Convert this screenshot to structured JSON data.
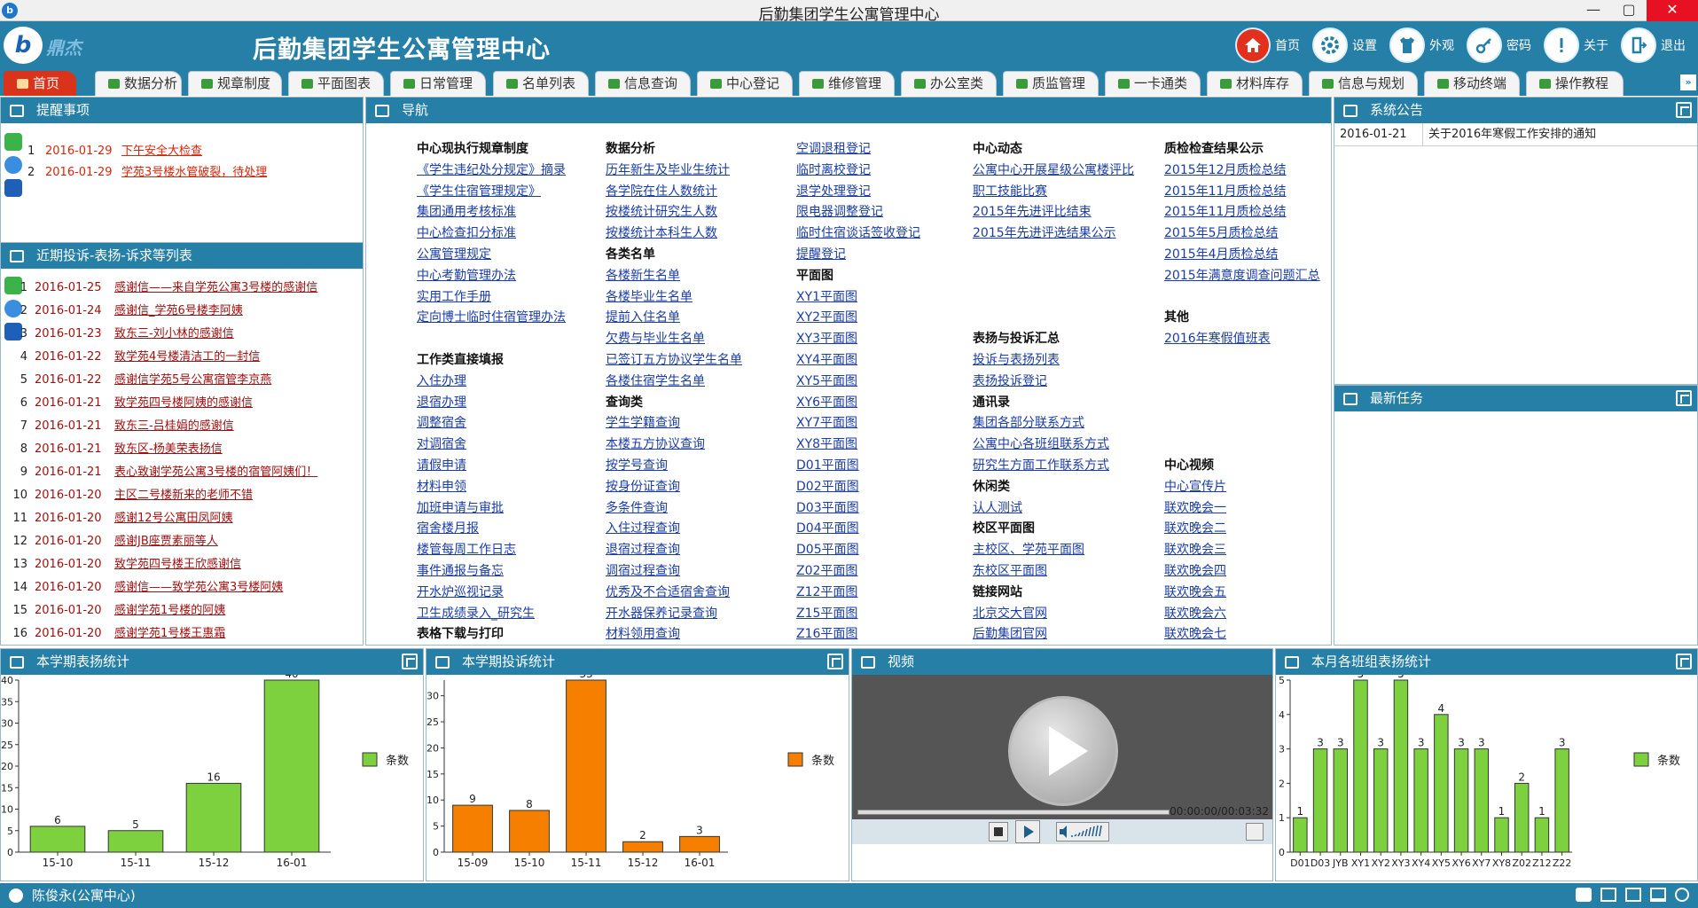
{
  "window": {
    "title": "后勤集团学生公寓管理中心"
  },
  "header": {
    "logo_text": "鼎杰",
    "app_title": "后勤集团学生公寓管理中心",
    "nav": [
      {
        "label": "首页",
        "icon": "home-icon"
      },
      {
        "label": "设置",
        "icon": "gear-icon"
      },
      {
        "label": "外观",
        "icon": "shirt-icon"
      },
      {
        "label": "密码",
        "icon": "key-icon"
      },
      {
        "label": "关于",
        "icon": "info-icon"
      },
      {
        "label": "退出",
        "icon": "exit-icon"
      }
    ]
  },
  "tabs": [
    "首页",
    "数据分析",
    "规章制度",
    "平面图表",
    "日常管理",
    "名单列表",
    "信息查询",
    "中心登记",
    "维修管理",
    "办公室类",
    "质监管理",
    "一卡通类",
    "材料库存",
    "信息与规划",
    "移动终端",
    "操作教程"
  ],
  "reminders": {
    "title": "提醒事项",
    "items": [
      {
        "num": "1",
        "date": "2016-01-29",
        "text": "下午安全大检查"
      },
      {
        "num": "2",
        "date": "2016-01-29",
        "text": "学苑3号楼水管破裂，待处理"
      }
    ]
  },
  "complaints": {
    "title": "近期投诉-表扬-诉求等列表",
    "items": [
      {
        "num": "1",
        "date": "2016-01-25",
        "text": "感谢信——来自学苑公寓3号楼的感谢信"
      },
      {
        "num": "2",
        "date": "2016-01-24",
        "text": "感谢信_学苑6号楼李阿姨"
      },
      {
        "num": "3",
        "date": "2016-01-23",
        "text": "致东三-刘小林的感谢信"
      },
      {
        "num": "4",
        "date": "2016-01-22",
        "text": "致学苑4号楼清洁工的一封信"
      },
      {
        "num": "5",
        "date": "2016-01-22",
        "text": "感谢信学苑5号公寓宿管李京燕"
      },
      {
        "num": "6",
        "date": "2016-01-21",
        "text": "致学苑四号楼阿姨的感谢信"
      },
      {
        "num": "7",
        "date": "2016-01-21",
        "text": "致东三-吕桂娟的感谢信"
      },
      {
        "num": "8",
        "date": "2016-01-21",
        "text": "致东区-杨美荣表扬信"
      },
      {
        "num": "9",
        "date": "2016-01-21",
        "text": "表心致谢学苑公寓3号楼的宿管阿姨们！"
      },
      {
        "num": "10",
        "date": "2016-01-20",
        "text": "主区二号楼新来的老师不错"
      },
      {
        "num": "11",
        "date": "2016-01-20",
        "text": "感谢12号公寓田凤阿姨"
      },
      {
        "num": "12",
        "date": "2016-01-20",
        "text": "感谢JB座贾素丽等人"
      },
      {
        "num": "13",
        "date": "2016-01-20",
        "text": "致学苑四号楼王欣感谢信"
      },
      {
        "num": "14",
        "date": "2016-01-20",
        "text": "感谢信——致学苑公寓3号楼阿姨"
      },
      {
        "num": "15",
        "date": "2016-01-20",
        "text": "感谢学苑1号楼的阿姨"
      },
      {
        "num": "16",
        "date": "2016-01-20",
        "text": "感谢学苑1号楼王惠霜"
      }
    ]
  },
  "nav_panel": {
    "title": "导航",
    "columns": [
      [
        {
          "t": "h",
          "text": "中心现执行规章制度"
        },
        {
          "t": "l",
          "text": "《学生违纪处分规定》摘录"
        },
        {
          "t": "l",
          "text": "《学生住宿管理规定》"
        },
        {
          "t": "l",
          "text": "集团通用考核标准"
        },
        {
          "t": "l",
          "text": "中心检查扣分标准"
        },
        {
          "t": "l",
          "text": "公寓管理规定"
        },
        {
          "t": "l",
          "text": "中心考勤管理办法"
        },
        {
          "t": "l",
          "text": "实用工作手册"
        },
        {
          "t": "l",
          "text": "定向博士临时住宿管理办法"
        },
        {
          "t": "e",
          "text": ""
        },
        {
          "t": "h",
          "text": "工作类直接填报"
        },
        {
          "t": "l",
          "text": "入住办理"
        },
        {
          "t": "l",
          "text": "退宿办理"
        },
        {
          "t": "l",
          "text": "调整宿舍"
        },
        {
          "t": "l",
          "text": "对调宿舍"
        },
        {
          "t": "l",
          "text": "请假申请"
        },
        {
          "t": "l",
          "text": "材料申领"
        },
        {
          "t": "l",
          "text": "加班申请与审批"
        },
        {
          "t": "l",
          "text": "宿舍楼月报"
        },
        {
          "t": "l",
          "text": "楼管每周工作日志"
        },
        {
          "t": "l",
          "text": "事件通报与备忘"
        },
        {
          "t": "l",
          "text": "开水炉巡视记录"
        },
        {
          "t": "l",
          "text": "卫生成绩录入_研究生"
        },
        {
          "t": "h",
          "text": "表格下载与打印"
        }
      ],
      [
        {
          "t": "h",
          "text": "数据分析"
        },
        {
          "t": "l",
          "text": "历年新生及毕业生统计"
        },
        {
          "t": "l",
          "text": "各学院在住人数统计"
        },
        {
          "t": "l",
          "text": "按楼统计研究生人数"
        },
        {
          "t": "l",
          "text": "按楼统计本科生人数"
        },
        {
          "t": "h",
          "text": "各类名单"
        },
        {
          "t": "l",
          "text": "各楼新生名单"
        },
        {
          "t": "l",
          "text": "各楼毕业生名单"
        },
        {
          "t": "l",
          "text": "提前入住名单"
        },
        {
          "t": "l",
          "text": "欠费与毕业生名单"
        },
        {
          "t": "l",
          "text": "已签订五方协议学生名单"
        },
        {
          "t": "l",
          "text": "各楼住宿学生名单"
        },
        {
          "t": "h",
          "text": "查询类"
        },
        {
          "t": "l",
          "text": "学生学籍查询"
        },
        {
          "t": "l",
          "text": "本楼五方协议查询"
        },
        {
          "t": "l",
          "text": "按学号查询"
        },
        {
          "t": "l",
          "text": "按身份证查询"
        },
        {
          "t": "l",
          "text": "多条件查询"
        },
        {
          "t": "l",
          "text": "入住过程查询"
        },
        {
          "t": "l",
          "text": "退宿过程查询"
        },
        {
          "t": "l",
          "text": "调宿过程查询"
        },
        {
          "t": "l",
          "text": "优秀及不合适宿舍查询"
        },
        {
          "t": "l",
          "text": "开水器保养记录查询"
        },
        {
          "t": "l",
          "text": "材料领用查询"
        }
      ],
      [
        {
          "t": "l",
          "text": "空调退租登记"
        },
        {
          "t": "l",
          "text": "临时离校登记"
        },
        {
          "t": "l",
          "text": "退学处理登记"
        },
        {
          "t": "l",
          "text": "限电器调整登记"
        },
        {
          "t": "l",
          "text": "临时住宿谈话签收登记"
        },
        {
          "t": "l",
          "text": "提醒登记"
        },
        {
          "t": "h",
          "text": "平面图"
        },
        {
          "t": "l",
          "text": "XY1平面图"
        },
        {
          "t": "l",
          "text": "XY2平面图"
        },
        {
          "t": "l",
          "text": "XY3平面图"
        },
        {
          "t": "l",
          "text": "XY4平面图"
        },
        {
          "t": "l",
          "text": "XY5平面图"
        },
        {
          "t": "l",
          "text": "XY6平面图"
        },
        {
          "t": "l",
          "text": "XY7平面图"
        },
        {
          "t": "l",
          "text": "XY8平面图"
        },
        {
          "t": "l",
          "text": "D01平面图"
        },
        {
          "t": "l",
          "text": "D02平面图"
        },
        {
          "t": "l",
          "text": "D03平面图"
        },
        {
          "t": "l",
          "text": "D04平面图"
        },
        {
          "t": "l",
          "text": "D05平面图"
        },
        {
          "t": "l",
          "text": "Z02平面图"
        },
        {
          "t": "l",
          "text": "Z12平面图"
        },
        {
          "t": "l",
          "text": "Z15平面图"
        },
        {
          "t": "l",
          "text": "Z16平面图"
        }
      ],
      [
        {
          "t": "h",
          "text": "中心动态"
        },
        {
          "t": "l",
          "text": "公寓中心开展星级公寓楼评比"
        },
        {
          "t": "l",
          "text": "职工技能比赛"
        },
        {
          "t": "l",
          "text": "2015年先进评比结束"
        },
        {
          "t": "l",
          "text": "2015年先进评选结果公示"
        },
        {
          "t": "e",
          "text": ""
        },
        {
          "t": "e",
          "text": ""
        },
        {
          "t": "e",
          "text": ""
        },
        {
          "t": "e",
          "text": ""
        },
        {
          "t": "h",
          "text": "表扬与投诉汇总"
        },
        {
          "t": "l",
          "text": "投诉与表扬列表"
        },
        {
          "t": "l",
          "text": "表扬投诉登记"
        },
        {
          "t": "h",
          "text": "通讯录"
        },
        {
          "t": "l",
          "text": "集团各部分联系方式"
        },
        {
          "t": "l",
          "text": "公寓中心各班组联系方式"
        },
        {
          "t": "l",
          "text": "研究生方面工作联系方式"
        },
        {
          "t": "h",
          "text": "休闲类"
        },
        {
          "t": "l",
          "text": "认人测试"
        },
        {
          "t": "h",
          "text": "校区平面图"
        },
        {
          "t": "l",
          "text": "主校区、学苑平面图"
        },
        {
          "t": "l",
          "text": "东校区平面图"
        },
        {
          "t": "h",
          "text": "链接网站"
        },
        {
          "t": "l",
          "text": "北京交大官网"
        },
        {
          "t": "l",
          "text": "后勤集团官网"
        }
      ],
      [
        {
          "t": "h",
          "text": "质检检查结果公示"
        },
        {
          "t": "l",
          "text": "2015年12月质检总结"
        },
        {
          "t": "l",
          "text": "2015年11月质检总结"
        },
        {
          "t": "l",
          "text": "2015年11月质检总结"
        },
        {
          "t": "l",
          "text": "2015年5月质检总结"
        },
        {
          "t": "l",
          "text": "2015年4月质检总结"
        },
        {
          "t": "l",
          "text": "2015年满意度调查问题汇总"
        },
        {
          "t": "e",
          "text": ""
        },
        {
          "t": "h",
          "text": "其他"
        },
        {
          "t": "l",
          "text": "2016年寒假值班表"
        },
        {
          "t": "e",
          "text": ""
        },
        {
          "t": "e",
          "text": ""
        },
        {
          "t": "e",
          "text": ""
        },
        {
          "t": "e",
          "text": ""
        },
        {
          "t": "e",
          "text": ""
        },
        {
          "t": "h",
          "text": "中心视频"
        },
        {
          "t": "l",
          "text": "中心宣传片"
        },
        {
          "t": "l",
          "text": "联欢晚会一"
        },
        {
          "t": "l",
          "text": "联欢晚会二"
        },
        {
          "t": "l",
          "text": "联欢晚会三"
        },
        {
          "t": "l",
          "text": "联欢晚会四"
        },
        {
          "t": "l",
          "text": "联欢晚会五"
        },
        {
          "t": "l",
          "text": "联欢晚会六"
        },
        {
          "t": "l",
          "text": "联欢晚会七"
        }
      ]
    ]
  },
  "notices": {
    "title": "系统公告",
    "items": [
      {
        "date": "2016-01-21",
        "text": "关于2016年寒假工作安排的通知"
      }
    ]
  },
  "tasks": {
    "title": "最新任务"
  },
  "video": {
    "title": "视频",
    "time": "00:00:00/00:03:32"
  },
  "status": {
    "user": "陈俊永(公寓中心)"
  },
  "chart_titles": [
    "本学期表扬统计",
    "本学期投诉统计",
    "本月各班组表扬统计"
  ],
  "chart_data": [
    {
      "type": "bar",
      "categories": [
        "15-10",
        "15-11",
        "15-12",
        "16-01"
      ],
      "values": [
        6,
        5,
        16,
        40
      ],
      "ylim": [
        0,
        40
      ],
      "yticks": [
        0,
        5,
        10,
        15,
        20,
        25,
        30,
        35,
        40
      ],
      "color": "#7ed13e",
      "series": [
        {
          "name": "条数",
          "values": [
            6,
            5,
            16,
            40
          ]
        }
      ]
    },
    {
      "type": "bar",
      "categories": [
        "15-09",
        "15-10",
        "15-11",
        "15-12",
        "16-01"
      ],
      "values": [
        9,
        8,
        33,
        2,
        3
      ],
      "ylim": [
        0,
        33
      ],
      "yticks": [
        0,
        5,
        10,
        15,
        20,
        25,
        30
      ],
      "color": "#f77f00",
      "series": [
        {
          "name": "条数",
          "values": [
            9,
            8,
            33,
            2,
            3
          ]
        }
      ]
    },
    {
      "type": "bar",
      "categories": [
        "D01",
        "D03",
        "JYB",
        "XY1",
        "XY2",
        "XY3",
        "XY4",
        "XY5",
        "XY6",
        "XY7",
        "XY8",
        "Z02",
        "Z12",
        "Z22"
      ],
      "values": [
        1,
        3,
        3,
        5,
        3,
        5,
        3,
        4,
        3,
        3,
        1,
        2,
        1,
        3
      ],
      "ylim": [
        0,
        5
      ],
      "yticks": [
        0,
        1,
        2,
        3,
        4,
        5
      ],
      "color": "#7ed13e",
      "series": [
        {
          "name": "条数",
          "values": [
            1,
            3,
            3,
            5,
            3,
            5,
            3,
            4,
            3,
            3,
            1,
            2,
            1,
            3
          ]
        }
      ]
    }
  ]
}
